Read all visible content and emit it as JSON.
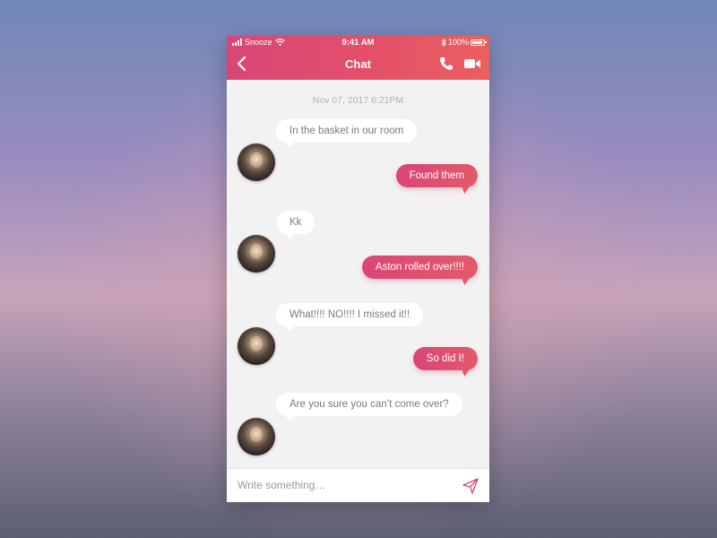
{
  "status_bar": {
    "carrier": "Snooze",
    "time": "9:41 AM",
    "battery": "100%"
  },
  "header": {
    "title": "Chat",
    "accent": "#d94676",
    "accent_end": "#ec5f5f"
  },
  "icons": {
    "back": "chevron-left-icon",
    "call": "phone-icon",
    "video": "video-camera-icon",
    "send": "paper-plane-icon"
  },
  "conversation": {
    "timestamp": "Nov 07, 2017 6:21PM",
    "messages": [
      {
        "from": "them",
        "text": "In the basket in our room"
      },
      {
        "from": "me",
        "text": "Found them"
      },
      {
        "from": "them",
        "text": "Kk"
      },
      {
        "from": "me",
        "text": "Aston rolled over!!!!"
      },
      {
        "from": "them",
        "text": "What!!!! NO!!!! I missed it!!"
      },
      {
        "from": "me",
        "text": "So did I!"
      },
      {
        "from": "them",
        "text": "Are you sure you can’t come over?"
      }
    ]
  },
  "composer": {
    "placeholder": "Write something…",
    "value": ""
  }
}
